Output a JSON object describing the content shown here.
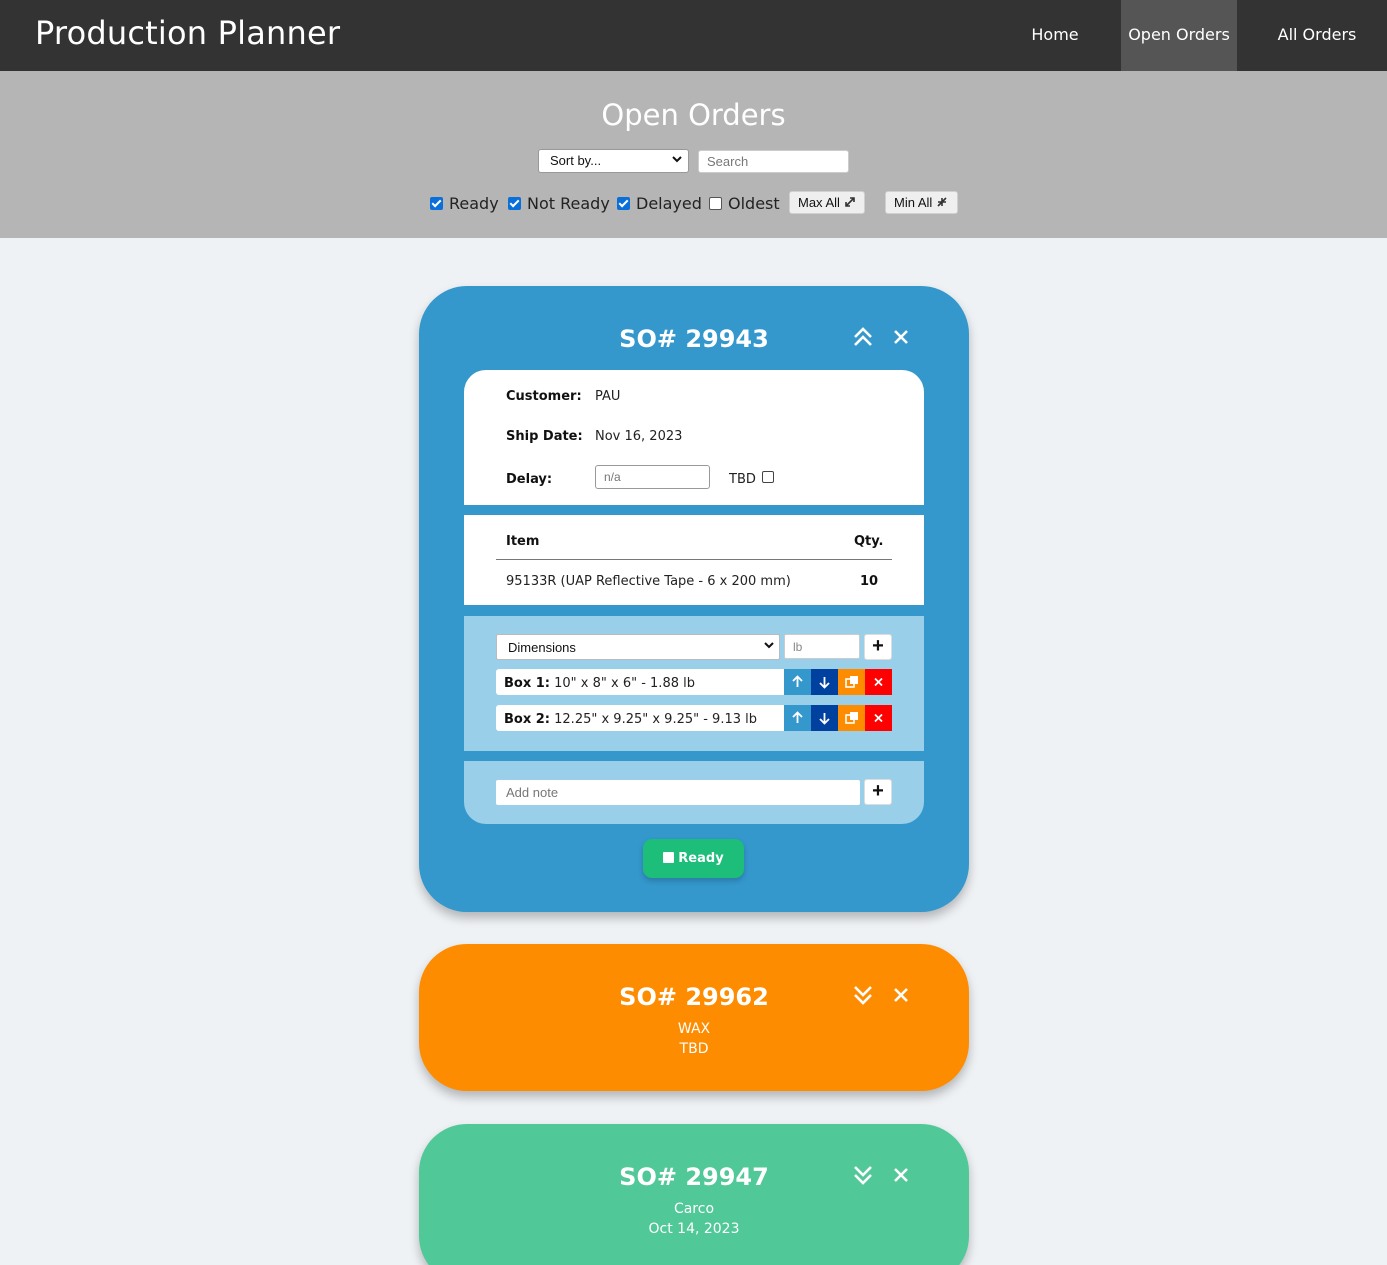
{
  "nav": {
    "brand": "Production Planner",
    "links": [
      "Home",
      "Open Orders",
      "All Orders"
    ],
    "active": "Open Orders"
  },
  "header": {
    "title": "Open Orders",
    "sort_placeholder": "Sort by...",
    "search_placeholder": "Search",
    "filters": [
      {
        "label": "Ready",
        "checked": true
      },
      {
        "label": "Not Ready",
        "checked": true
      },
      {
        "label": "Delayed",
        "checked": true
      },
      {
        "label": "Oldest",
        "checked": false
      }
    ],
    "max_all": "Max All",
    "min_all": "Min All"
  },
  "orders": [
    {
      "so": "SO# 29943",
      "color": "#3498cd",
      "expanded": true,
      "customer_label": "Customer:",
      "customer": "PAU",
      "ship_label": "Ship Date:",
      "ship_date": "Nov 16, 2023",
      "delay_label": "Delay:",
      "delay_placeholder": "n/a",
      "tbd_label": "TBD",
      "items_header": {
        "item": "Item",
        "qty": "Qty."
      },
      "items": [
        {
          "item": "95133R (UAP Reflective Tape - 6 x 200 mm)",
          "qty": "10"
        }
      ],
      "dimensions_placeholder": "Dimensions",
      "weight_placeholder": "lb",
      "boxes": [
        {
          "label": "Box 1:",
          "value": "10\" x 8\" x 6\" - 1.88 lb"
        },
        {
          "label": "Box 2:",
          "value": "12.25\" x 9.25\" x 9.25\" - 9.13 lb"
        }
      ],
      "note_placeholder": "Add note",
      "status_button": "Ready"
    },
    {
      "so": "SO# 29962",
      "color": "#fe8c01",
      "expanded": false,
      "customer": "WAX",
      "ship_date": "TBD"
    },
    {
      "so": "SO# 29947",
      "color": "#51c897",
      "expanded": false,
      "customer": "Carco",
      "ship_date": "Oct 14, 2023"
    }
  ]
}
